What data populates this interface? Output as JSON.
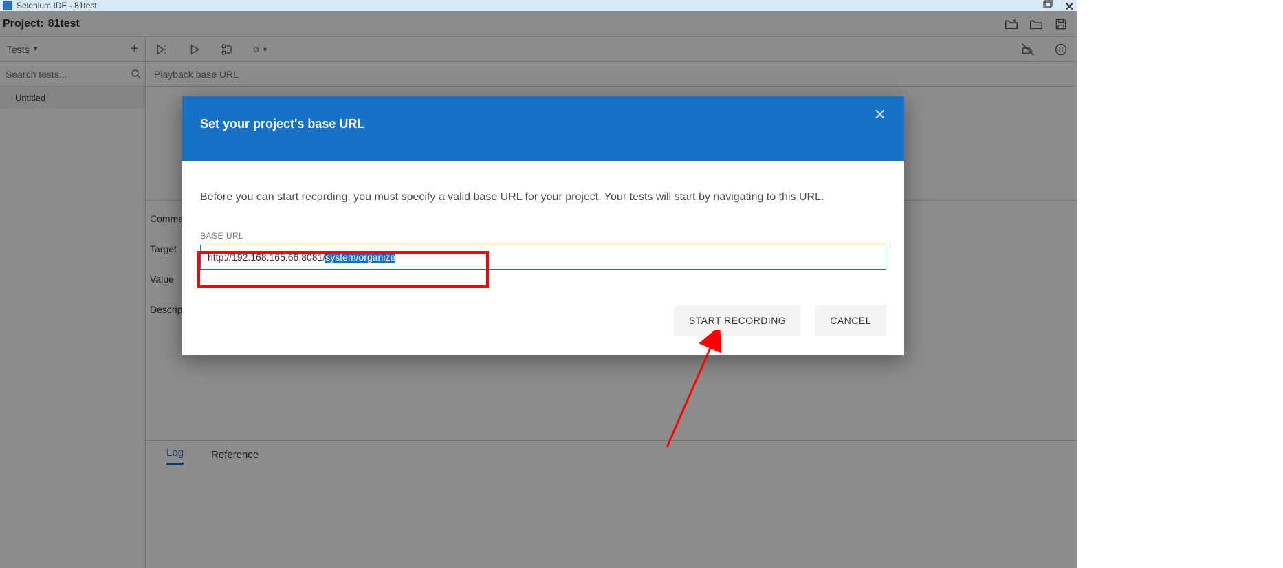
{
  "title_bar": {
    "text": "Selenium IDE - 81test"
  },
  "project": {
    "label": "Project:",
    "name": "81test"
  },
  "sidebar": {
    "tests_label": "Tests",
    "search_placeholder": "Search tests...",
    "items": [
      {
        "label": "Untitled"
      }
    ]
  },
  "url_bar": {
    "placeholder": "Playback base URL"
  },
  "form": {
    "command_label": "Command",
    "target_label": "Target",
    "value_label": "Value",
    "description_label": "Description"
  },
  "bottom_tabs": {
    "log": "Log",
    "reference": "Reference"
  },
  "modal": {
    "title": "Set your project's base URL",
    "description": "Before you can start recording, you must specify a valid base URL for your project. Your tests will start by navigating to this URL.",
    "field_label": "BASE URL",
    "url_plain": "http://192.168.165.66:8081/",
    "url_selected": "system/organize",
    "start_label": "START RECORDING",
    "cancel_label": "CANCEL"
  }
}
